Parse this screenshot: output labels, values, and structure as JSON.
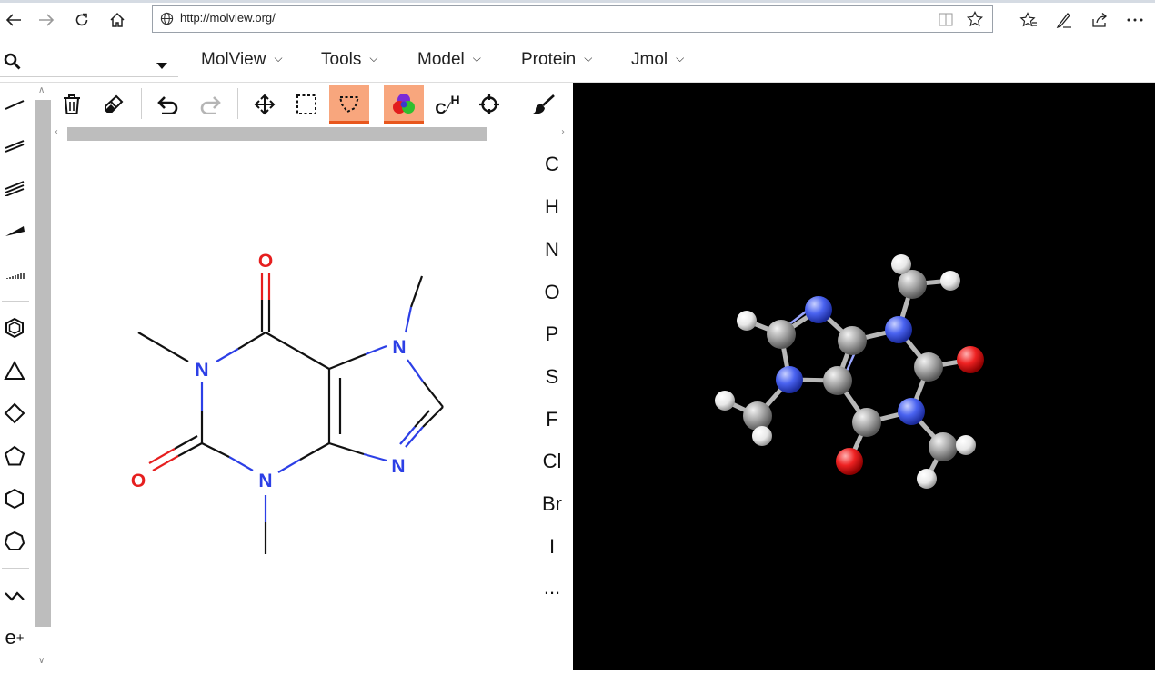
{
  "browser": {
    "url": "http://molview.org/",
    "nav_icons": [
      "back-icon",
      "forward-icon",
      "refresh-icon",
      "home-icon"
    ],
    "address_icons": [
      "globe-icon",
      "reading-view-icon",
      "favorite-star-icon"
    ],
    "toolbar_icons": [
      "favorites-icon",
      "pen-notes-icon",
      "share-icon",
      "more-icon"
    ]
  },
  "menubar": {
    "search_placeholder": "",
    "menus": [
      {
        "label": "MolView"
      },
      {
        "label": "Tools"
      },
      {
        "label": "Model"
      },
      {
        "label": "Protein"
      },
      {
        "label": "Jmol"
      }
    ]
  },
  "sketcher": {
    "left_tools": [
      "single-bond-icon",
      "double-bond-icon",
      "triple-bond-icon",
      "wedge-bond-icon",
      "hash-bond-icon",
      "benzene-icon",
      "cyclopropane-icon",
      "cyclobutane-icon",
      "cyclopentane-icon",
      "cyclohexane-icon",
      "cycloheptane-icon",
      "chain-icon",
      "charge-icon"
    ],
    "charge_label": "e",
    "charge_sup": "+",
    "top_tools": [
      "trash-icon",
      "eraser-icon",
      "undo-icon",
      "redo-icon",
      "move-icon",
      "rect-select-icon",
      "lasso-select-icon",
      "color-mode-icon",
      "hydrogen-toggle-icon",
      "center-icon",
      "clean-brush-icon"
    ],
    "active_tools": [
      "lasso-select-icon",
      "color-mode-icon"
    ],
    "hydrogen_icon_text": {
      "c": "C",
      "h": "H"
    },
    "elements": [
      "C",
      "H",
      "N",
      "O",
      "P",
      "S",
      "F",
      "Cl",
      "Br",
      "I",
      "..."
    ],
    "atoms": {
      "o1": "O",
      "o2": "O",
      "n1": "N",
      "n3": "N",
      "n7": "N",
      "n9": "N"
    }
  },
  "colors": {
    "nitrogen": "#2c3fe6",
    "oxygen": "#e61f1f",
    "bond": "#111111",
    "active_tool": "#f8a67d",
    "active_tool_border": "#e8571d",
    "viewer_bg": "#000000"
  }
}
